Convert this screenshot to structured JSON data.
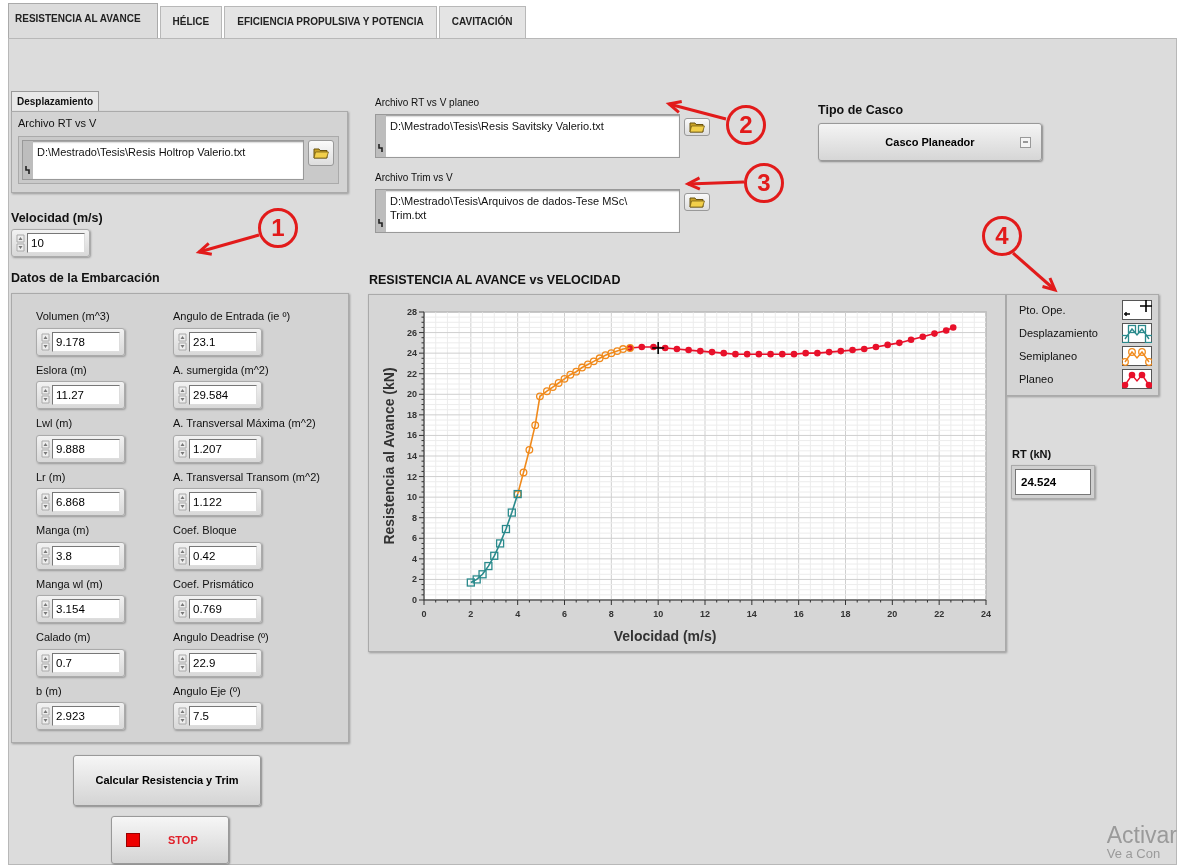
{
  "tabs": [
    {
      "label": "RESISTENCIA AL AVANCE",
      "selected": true
    },
    {
      "label": "HÉLICE",
      "selected": false
    },
    {
      "label": "EFICIENCIA PROPULSIVA Y POTENCIA",
      "selected": false
    },
    {
      "label": "CAVITACIÓN",
      "selected": false
    }
  ],
  "displacement_group": {
    "tab_label": "Desplazamiento",
    "file_label": "Archivo RT vs V",
    "file_path": "D:\\Mestrado\\Tesis\\Resis Holtrop Valerio.txt"
  },
  "velocity": {
    "label": "Velocidad (m/s)",
    "value": "10"
  },
  "vessel_data": {
    "title": "Datos de la Embarcación",
    "columns": [
      [
        {
          "label": "Volumen (m^3)",
          "value": "9.178"
        },
        {
          "label": "Eslora (m)",
          "value": "11.27"
        },
        {
          "label": "Lwl (m)",
          "value": "9.888"
        },
        {
          "label": "Lr (m)",
          "value": "6.868"
        },
        {
          "label": "Manga (m)",
          "value": "3.8"
        },
        {
          "label": "Manga wl (m)",
          "value": "3.154"
        },
        {
          "label": "Calado (m)",
          "value": "0.7"
        },
        {
          "label": "b (m)",
          "value": "2.923"
        }
      ],
      [
        {
          "label": "Angulo de Entrada (ie º)",
          "value": "23.1"
        },
        {
          "label": "A. sumergida (m^2)",
          "value": "29.584"
        },
        {
          "label": "A. Transversal Máxima (m^2)",
          "value": "1.207"
        },
        {
          "label": "A. Transversal Transom (m^2)",
          "value": "1.122"
        },
        {
          "label": "Coef. Bloque",
          "value": "0.42"
        },
        {
          "label": "Coef. Prismático",
          "value": "0.769"
        },
        {
          "label": "Angulo Deadrise (º)",
          "value": "22.9"
        },
        {
          "label": "Angulo Eje (º)",
          "value": "7.5"
        }
      ]
    ]
  },
  "buttons": [
    {
      "label": "Calcular Resistencia y Trim",
      "kind": "calculate"
    },
    {
      "label": "STOP",
      "kind": "stop"
    }
  ],
  "planing_file": {
    "label": "Archivo RT vs V planeo",
    "path_lines": [
      "D:\\Mestrado\\Tesis\\Resis Savitsky Valerio.txt"
    ]
  },
  "trim_file": {
    "label": "Archivo Trim vs V",
    "path_lines": [
      "D:\\Mestrado\\Tesis\\Arquivos de dados-Tese MSc\\",
      "Trim.txt"
    ]
  },
  "hull_type": {
    "label": "Tipo de Casco",
    "value": "Casco Planeador"
  },
  "chart": {
    "chart_data": {
      "type": "line",
      "grid": true,
      "title": "RESISTENCIA AL AVANCE vs VELOCIDAD",
      "xlabel": "Velocidad (m/s)",
      "ylabel": "Resistencia al Avance (kN)",
      "xlim": [
        0,
        24
      ],
      "ylim": [
        0,
        28
      ],
      "xticks": [
        0,
        2,
        4,
        6,
        8,
        10,
        12,
        14,
        16,
        18,
        20,
        22,
        24
      ],
      "yticks": [
        0,
        2,
        4,
        6,
        8,
        10,
        12,
        14,
        16,
        18,
        20,
        22,
        24,
        26,
        28
      ],
      "series": [
        {
          "name": "Pto. Ope.",
          "color": "#000000",
          "marker": "cross",
          "x": [
            10
          ],
          "values": [
            24.5
          ]
        },
        {
          "name": "Desplazamiento",
          "color": "#2a8a8c",
          "marker": "square",
          "x": [
            2.0,
            2.25,
            2.5,
            2.75,
            3.0,
            3.25,
            3.5,
            3.75,
            4.0
          ],
          "values": [
            1.7,
            2.0,
            2.5,
            3.3,
            4.3,
            5.5,
            6.9,
            8.5,
            10.3
          ]
        },
        {
          "name": "Semiplaneo",
          "color": "#f08a1c",
          "marker": "circle",
          "x": [
            4.0,
            4.25,
            4.5,
            4.75,
            4.95,
            5.25,
            5.5,
            5.75,
            6.0,
            6.25,
            6.5,
            6.75,
            7.0,
            7.25,
            7.5,
            7.75,
            8.0,
            8.25,
            8.5,
            8.8
          ],
          "values": [
            10.3,
            12.4,
            14.6,
            17.0,
            19.8,
            20.3,
            20.7,
            21.1,
            21.5,
            21.9,
            22.2,
            22.6,
            22.9,
            23.2,
            23.5,
            23.8,
            24.0,
            24.2,
            24.4,
            24.5
          ]
        },
        {
          "name": "Planeo",
          "color": "#e8102a",
          "marker": "dot",
          "x": [
            8.8,
            9.3,
            9.8,
            10.3,
            10.8,
            11.3,
            11.8,
            12.3,
            12.8,
            13.3,
            13.8,
            14.3,
            14.8,
            15.3,
            15.8,
            16.3,
            16.8,
            17.3,
            17.8,
            18.3,
            18.8,
            19.3,
            19.8,
            20.3,
            20.8,
            21.3,
            21.8,
            22.3,
            22.6
          ],
          "values": [
            24.5,
            24.6,
            24.6,
            24.5,
            24.4,
            24.3,
            24.2,
            24.1,
            24.0,
            23.9,
            23.9,
            23.9,
            23.9,
            23.9,
            23.9,
            24.0,
            24.0,
            24.1,
            24.2,
            24.3,
            24.4,
            24.6,
            24.8,
            25.0,
            25.3,
            25.6,
            25.9,
            26.2,
            26.5
          ]
        }
      ]
    }
  },
  "rt": {
    "label": "RT (kN)",
    "value": "24.524"
  },
  "callouts": [
    {
      "number": "1"
    },
    {
      "number": "2"
    },
    {
      "number": "3"
    },
    {
      "number": "4"
    }
  ],
  "os_notice": {
    "lines": [
      "Activar",
      "Ve a Con"
    ]
  }
}
